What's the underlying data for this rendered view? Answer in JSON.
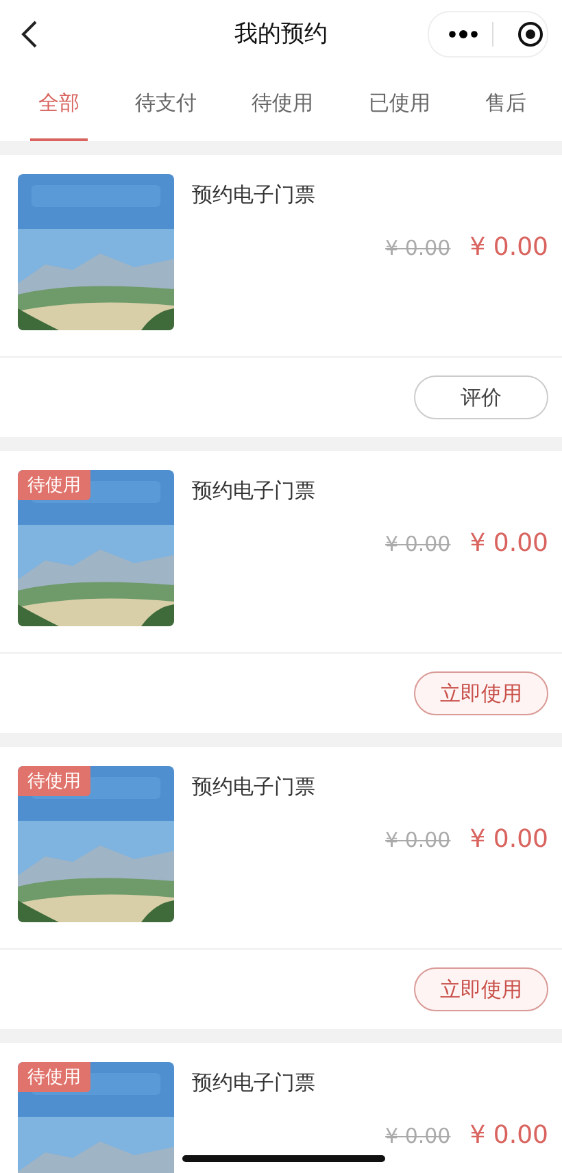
{
  "header": {
    "title": "我的预约"
  },
  "tabs": [
    {
      "label": "全部",
      "selected": true
    },
    {
      "label": "待支付",
      "selected": false
    },
    {
      "label": "待使用",
      "selected": false
    },
    {
      "label": "已使用",
      "selected": false
    },
    {
      "label": "售后",
      "selected": false
    }
  ],
  "orders": [
    {
      "title": "预约电子门票",
      "original_price": "¥ 0.00",
      "price": "¥ 0.00",
      "action": {
        "label": "评价",
        "kind": "plain"
      }
    },
    {
      "badge": "待使用",
      "title": "预约电子门票",
      "original_price": "¥ 0.00",
      "price": "¥ 0.00",
      "action": {
        "label": "立即使用",
        "kind": "primary"
      }
    },
    {
      "badge": "待使用",
      "title": "预约电子门票",
      "original_price": "¥ 0.00",
      "price": "¥ 0.00",
      "action": {
        "label": "立即使用",
        "kind": "primary"
      }
    },
    {
      "badge": "待使用",
      "title": "预约电子门票",
      "original_price": "¥ 0.00",
      "price": "¥ 0.00"
    }
  ]
}
